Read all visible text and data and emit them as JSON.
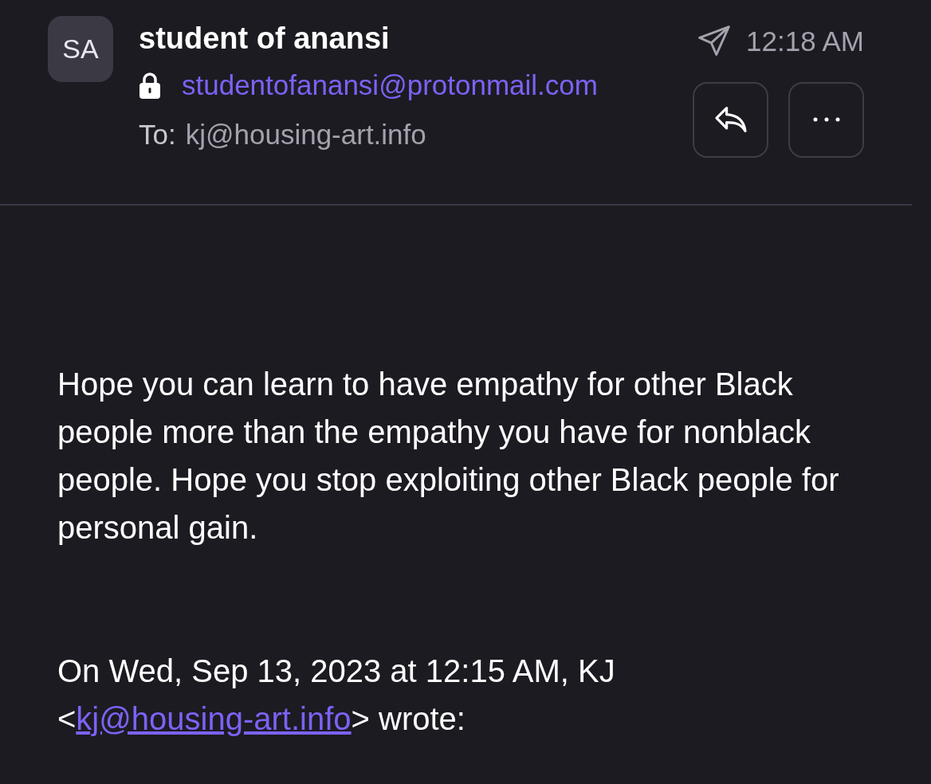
{
  "sender": {
    "initials": "SA",
    "name": "student of anansi",
    "email": "studentofanansi@protonmail.com",
    "to_label": "To:",
    "to": "kj@housing-art.info",
    "time": "12:18 AM"
  },
  "body": "Hope you can learn to have empathy for other Black people more than the empathy you have for nonblack people. Hope you stop exploiting other Black people for personal gain.",
  "quote": {
    "prefix": "On Wed, Sep 13, 2023 at 12:15 AM, KJ <",
    "link": "kj@housing-art.info",
    "suffix": "> wrote:"
  }
}
